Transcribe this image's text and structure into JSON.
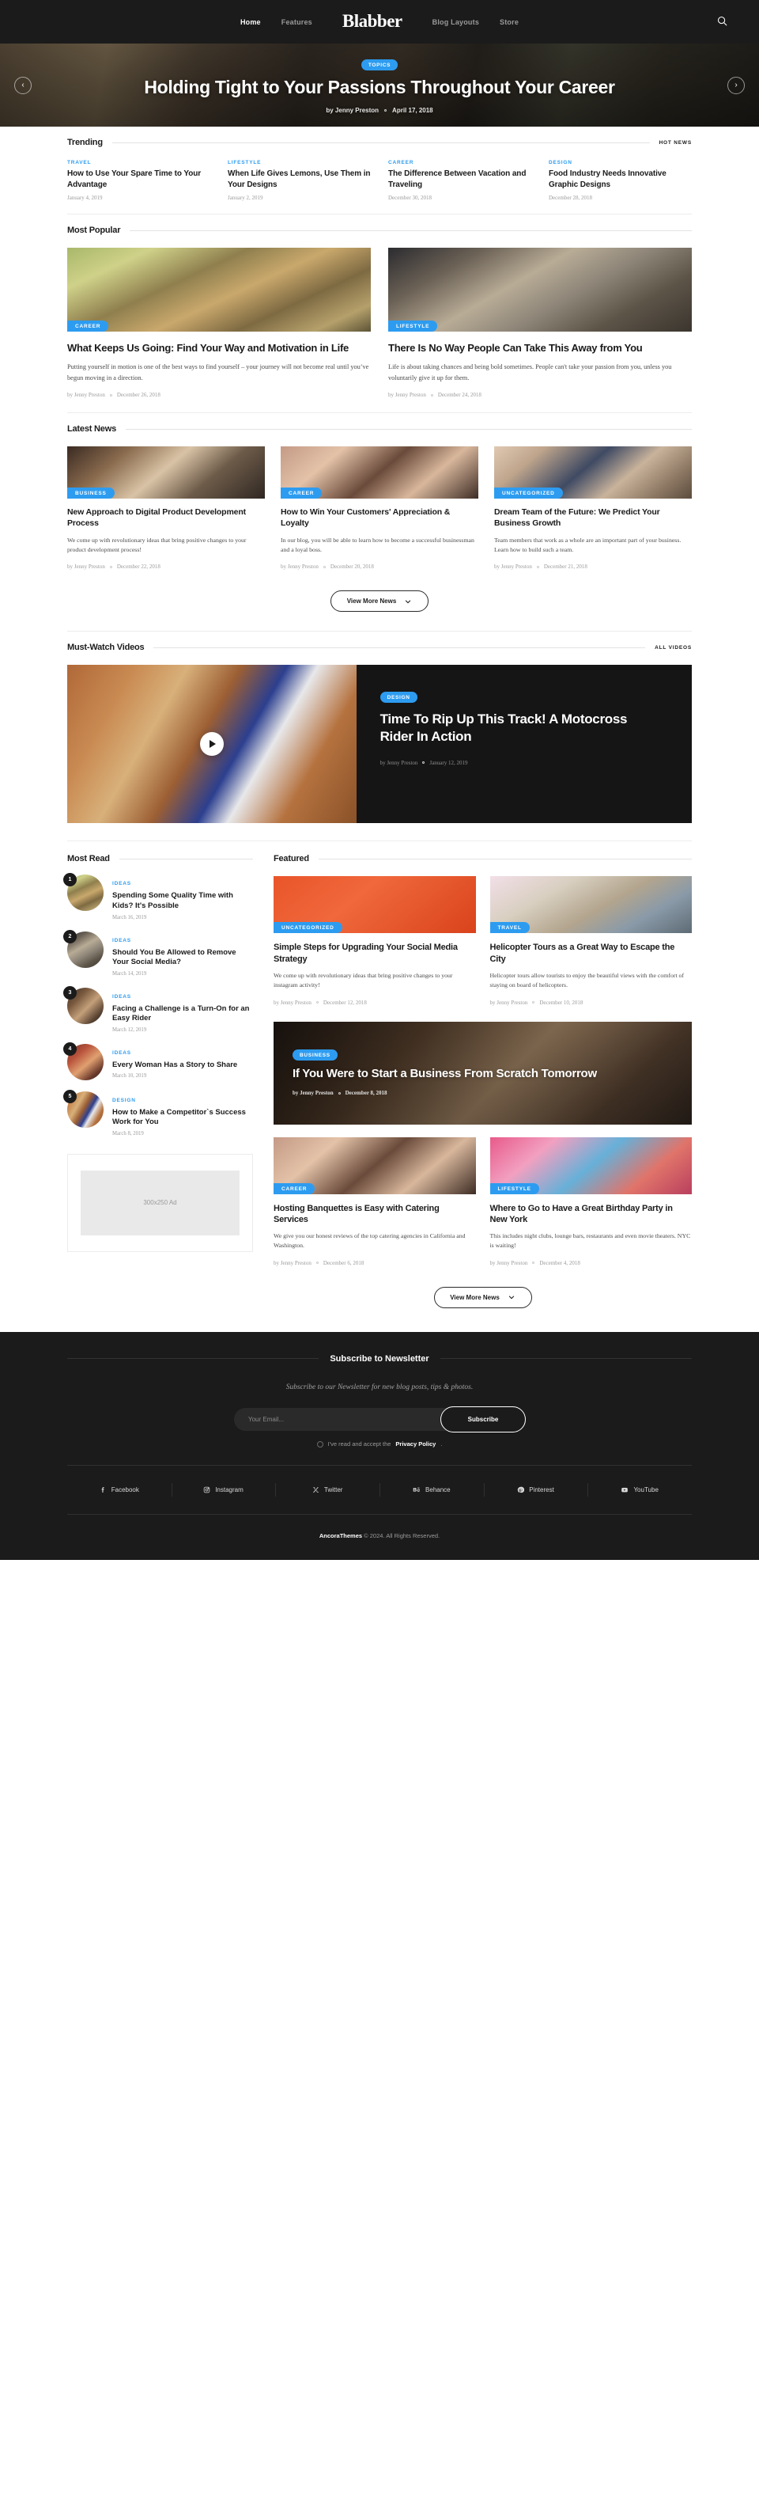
{
  "header": {
    "brand": "Blabber",
    "nav": [
      {
        "label": "Home",
        "active": true
      },
      {
        "label": "Features",
        "active": false
      },
      {
        "label": "Blog Layouts",
        "active": false
      },
      {
        "label": "Store",
        "active": false
      }
    ],
    "search_icon": "search-icon"
  },
  "hero": {
    "badge": "TOPICS",
    "title": "Holding Tight to Your Passions Throughout Your Career",
    "author": "by Jenny Preston",
    "date": "April 17, 2018",
    "prev": "‹",
    "next": "›"
  },
  "trending": {
    "title": "Trending",
    "link": "HOT NEWS",
    "items": [
      {
        "cat": "TRAVEL",
        "title": "How to Use Your Spare Time to Your Advantage",
        "date": "January 4, 2019"
      },
      {
        "cat": "LIFESTYLE",
        "title": "When Life Gives Lemons, Use Them in Your Designs",
        "date": "January 2, 2019"
      },
      {
        "cat": "CAREER",
        "title": "The Difference Between Vacation and Traveling",
        "date": "December 30, 2018"
      },
      {
        "cat": "DESIGN",
        "title": "Food Industry Needs Innovative Graphic Designs",
        "date": "December 28, 2018"
      }
    ]
  },
  "most_popular": {
    "title": "Most Popular",
    "items": [
      {
        "cat": "CAREER",
        "title": "What Keeps Us Going: Find Your Way and Motivation in Life",
        "excerpt": "Putting yourself in motion is one of the best ways to find yourself – your journey will not become real until you’ve begun moving in a direction.",
        "author": "by Jenny Preston",
        "date": "December 26, 2018"
      },
      {
        "cat": "LIFESTYLE",
        "title": "There Is No Way People Can Take This Away from You",
        "excerpt": "Life is about taking chances and being bold sometimes. People can't take your passion from you, unless you voluntarily give it up for them.",
        "author": "by Jenny Preston",
        "date": "December 24, 2018"
      }
    ]
  },
  "latest_news": {
    "title": "Latest News",
    "button": "View More News",
    "items": [
      {
        "cat": "BUSINESS",
        "title": "New Approach to Digital Product Development Process",
        "excerpt": "We come up with revolutionary ideas that bring positive changes to your product development process!",
        "author": "by Jenny Preston",
        "date": "December 22, 2018"
      },
      {
        "cat": "CAREER",
        "title": "How to Win Your Customers' Appreciation & Loyalty",
        "excerpt": "In our blog, you will be able to learn how to become a successful businessman and a loyal boss.",
        "author": "by Jenny Preston",
        "date": "December 20, 2018"
      },
      {
        "cat": "UNCATEGORIZED",
        "title": "Dream Team of the Future: We Predict Your Business Growth",
        "excerpt": "Team members that work as a whole are an important part of your business. Learn how to build such a team.",
        "author": "by Jenny Preston",
        "date": "December 21, 2018"
      }
    ]
  },
  "videos": {
    "title": "Must-Watch Videos",
    "link": "ALL VIDEOS",
    "featured": {
      "cat": "DESIGN",
      "title": "Time To Rip Up This Track! A Motocross Rider In Action",
      "author": "by Jenny Preston",
      "date": "January 12, 2019"
    }
  },
  "most_read": {
    "title": "Most Read",
    "items": [
      {
        "rank": "1",
        "cat": "IDEAS",
        "title": "Spending Some Quality Time with Kids? It's Possible",
        "date": "March 16, 2019"
      },
      {
        "rank": "2",
        "cat": "IDEAS",
        "title": "Should You Be Allowed to Remove Your Social Media?",
        "date": "March 14, 2019"
      },
      {
        "rank": "3",
        "cat": "IDEAS",
        "title": "Facing a Challenge is a Turn-On for an Easy Rider",
        "date": "March 12, 2019"
      },
      {
        "rank": "4",
        "cat": "IDEAS",
        "title": "Every Woman Has a Story to Share",
        "date": "March 10, 2019"
      },
      {
        "rank": "5",
        "cat": "DESIGN",
        "title": "How to Make a Competitor`s Success Work for You",
        "date": "March 8, 2019"
      }
    ],
    "ad_label": "300x250 Ad"
  },
  "featured": {
    "title": "Featured",
    "button": "View More News",
    "items": [
      {
        "cat": "UNCATEGORIZED",
        "title": "Simple Steps for Upgrading Your Social Media Strategy",
        "excerpt": "We come up with revolutionary ideas that bring positive changes to your instagram activity!",
        "author": "by Jenny Preston",
        "date": "December 12, 2018"
      },
      {
        "cat": "TRAVEL",
        "title": "Helicopter Tours as a Great Way to Escape the City",
        "excerpt": "Helicopter tours allow tourists to enjoy the beautiful views with the comfort of staying on board of helicopters.",
        "author": "by Jenny Preston",
        "date": "December 10, 2018"
      },
      {
        "cat": "CAREER",
        "title": "Hosting Banquettes is Easy with Catering Services",
        "excerpt": "We give you our honest reviews of the top catering agencies in California and Washington.",
        "author": "by Jenny Preston",
        "date": "December 6, 2018"
      },
      {
        "cat": "LIFESTYLE",
        "title": "Where to Go to Have a Great Birthday Party in New York",
        "excerpt": "This includes night clubs, lounge bars, restaurants and even movie theaters. NYC is waiting!",
        "author": "by Jenny Preston",
        "date": "December 4, 2018"
      }
    ],
    "wide": {
      "cat": "BUSINESS",
      "title": "If You Were to Start a Business From Scratch Tomorrow",
      "author": "by Jenny Preston",
      "date": "December 8, 2018"
    }
  },
  "footer": {
    "title": "Subscribe to Newsletter",
    "subtitle": "Subscribe to our Newsletter for new blog posts, tips & photos.",
    "email_placeholder": "Your Email...",
    "subscribe_label": "Subscribe",
    "consent_text": "I've read and accept the",
    "privacy_label": "Privacy Policy",
    "consent_tail": ".",
    "socials": [
      {
        "label": "Facebook",
        "icon": "facebook-icon"
      },
      {
        "label": "Instagram",
        "icon": "instagram-icon"
      },
      {
        "label": "Twitter",
        "icon": "twitter-icon"
      },
      {
        "label": "Behance",
        "icon": "behance-icon"
      },
      {
        "label": "Pinterest",
        "icon": "pinterest-icon"
      },
      {
        "label": "YouTube",
        "icon": "youtube-icon"
      }
    ],
    "copyright_brand": "AncoraThemes",
    "copyright_rest": "© 2024. All Rights Reserved."
  },
  "colors": {
    "accent": "#2d9cf0",
    "dark": "#1b1b1b"
  }
}
